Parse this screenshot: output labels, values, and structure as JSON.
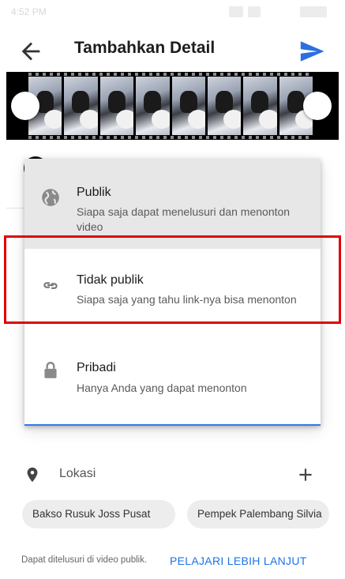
{
  "status_bar": {
    "time": "4:52 PM"
  },
  "header": {
    "title": "Tambahkan Detail",
    "back_icon": "arrow-left-icon",
    "send_icon": "send-icon"
  },
  "filmstrip": {
    "frame_count": 8
  },
  "visibility_menu": {
    "options": [
      {
        "id": "public",
        "title": "Publik",
        "description": "Siapa saja dapat menelusuri dan menonton video",
        "icon": "globe-icon"
      },
      {
        "id": "unlisted",
        "title": "Tidak publik",
        "description": "Siapa saja yang tahu link-nya bisa menonton",
        "icon": "link-icon"
      },
      {
        "id": "private",
        "title": "Pribadi",
        "description": "Hanya Anda yang dapat menonton",
        "icon": "lock-icon"
      }
    ],
    "highlighted_option": "unlisted"
  },
  "location": {
    "label": "Lokasi",
    "suggestions": [
      "Bakso Rusuk Joss Pusat",
      "Pempek Palembang Silvia"
    ]
  },
  "footer": {
    "note": "Dapat ditelusuri di video publik.",
    "learn_more": "PELAJARI LEBIH LANJUT"
  },
  "colors": {
    "accent": "#1a73e8",
    "send": "#2b6fe0",
    "highlight_border": "#e10000",
    "selected_bg": "#e7e7e7"
  }
}
